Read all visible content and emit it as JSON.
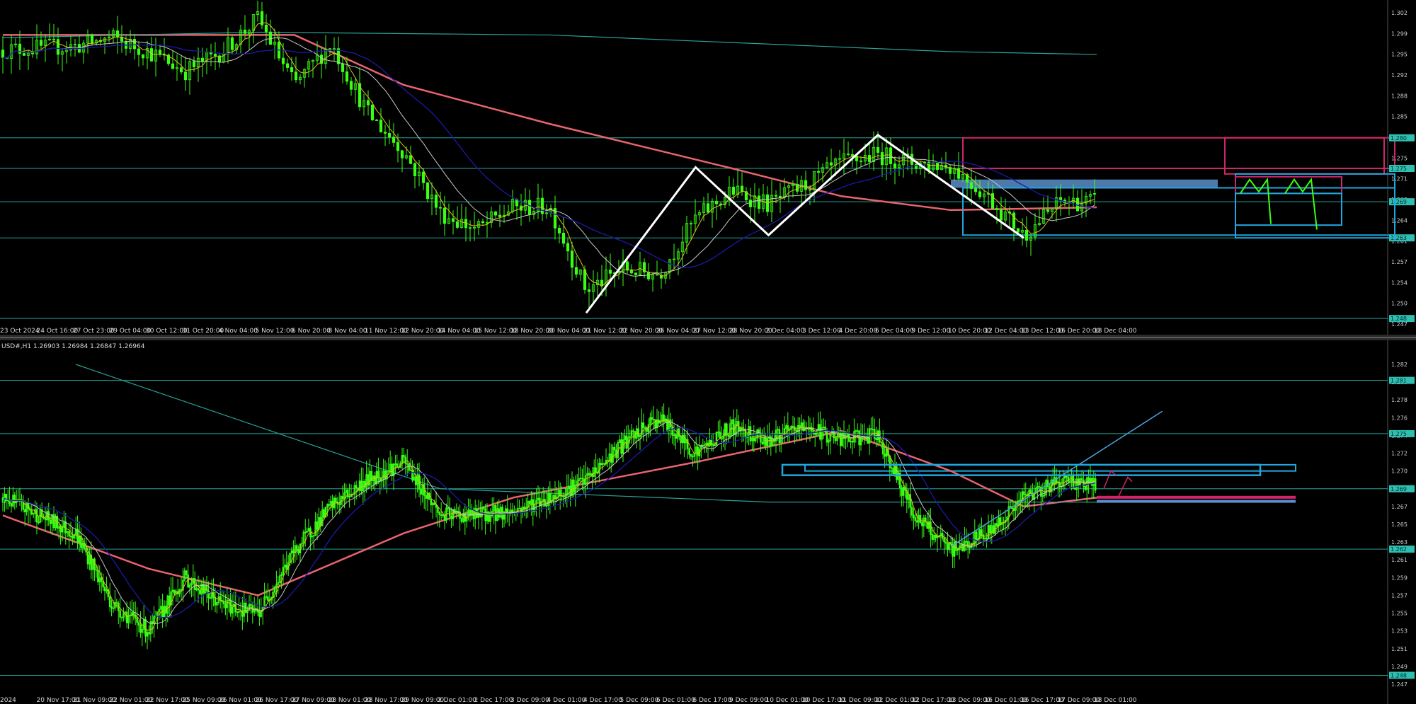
{
  "colors": {
    "background": "#000000",
    "candle": "#39ff14",
    "ma_red": "#e8646e",
    "ma_blue": "#1a1aa8",
    "ma_teal": "#2aa198",
    "ma_gray": "#c8c8c8",
    "ma_yellow": "#e0c020",
    "level_line": "#2fbfb0",
    "pattern_white": "#ffffff",
    "zone_steelblue": "#5b8ec9",
    "zone_cyan": "#1ea7e0",
    "zone_magenta": "#d0256a"
  },
  "top_chart": {
    "header": "",
    "x_ticks": [
      "23 Oct 2024",
      "24 Oct 16:00",
      "27 Oct 23:00",
      "29 Oct 04:00",
      "30 Oct 12:00",
      "31 Oct 20:00",
      "4 Nov 04:00",
      "5 Nov 12:00",
      "6 Nov 20:00",
      "8 Nov 04:00",
      "11 Nov 12:00",
      "12 Nov 20:00",
      "14 Nov 04:00",
      "15 Nov 12:00",
      "18 Nov 20:00",
      "20 Nov 04:00",
      "21 Nov 12:00",
      "22 Nov 20:00",
      "26 Nov 04:00",
      "27 Nov 12:00",
      "28 Nov 20:00",
      "2 Dec 04:00",
      "3 Dec 12:00",
      "4 Dec 20:00",
      "6 Dec 04:00",
      "9 Dec 12:00",
      "10 Dec 20:00",
      "12 Dec 04:00",
      "13 Dec 12:00",
      "16 Dec 20:00",
      "18 Dec 04:00"
    ],
    "y_ticks": [
      "1.302",
      "1.299",
      "1.295",
      "1.292",
      "1.288",
      "1.285",
      "1.278",
      "1.275",
      "1.271",
      "1.268",
      "1.264",
      "1.261",
      "1.257",
      "1.254",
      "1.250",
      "1.247"
    ],
    "price_markers": [
      "1.280",
      "1.275",
      "1.269",
      "1.263",
      "1.248"
    ]
  },
  "bottom_chart": {
    "header": "USD#,H1  1.26903 1.26984 1.26847 1.26964",
    "x_ticks": [
      "2024",
      "20 Nov 17:00",
      "21 Nov 09:00",
      "22 Nov 01:00",
      "22 Nov 17:00",
      "25 Nov 09:00",
      "26 Nov 01:00",
      "26 Nov 17:00",
      "27 Nov 09:00",
      "28 Nov 01:00",
      "28 Nov 17:00",
      "29 Nov 09:00",
      "2 Dec 01:00",
      "2 Dec 17:00",
      "3 Dec 09:00",
      "4 Dec 01:00",
      "4 Dec 17:00",
      "5 Dec 09:00",
      "6 Dec 01:00",
      "6 Dec 17:00",
      "9 Dec 09:00",
      "10 Dec 01:00",
      "10 Dec 17:00",
      "11 Dec 09:00",
      "12 Dec 01:00",
      "12 Dec 17:00",
      "13 Dec 09:00",
      "16 Dec 01:00",
      "16 Dec 17:00",
      "17 Dec 09:00",
      "18 Dec 01:00"
    ],
    "y_ticks": [
      "1.282",
      "1.280",
      "1.278",
      "1.276",
      "1.274",
      "1.272",
      "1.270",
      "1.268",
      "1.267",
      "1.265",
      "1.263",
      "1.261",
      "1.259",
      "1.257",
      "1.255",
      "1.253",
      "1.251",
      "1.249",
      "1.247"
    ],
    "price_markers": [
      "1.281",
      "1.275",
      "1.269",
      "1.262",
      "1.248"
    ]
  },
  "chart_data": [
    {
      "type": "candlestick",
      "timeframe": "H4",
      "x_range": [
        "23 Oct 2024",
        "18 Dec 04:00"
      ],
      "ylim": [
        1.247,
        1.303
      ],
      "close_path": [
        [
          "23 Oct 2024",
          1.2963
        ],
        [
          "27 Oct 23:00",
          1.297
        ],
        [
          "29 Oct 04:00",
          1.2985
        ],
        [
          "30 Oct 12:00",
          1.296
        ],
        [
          "31 Oct 20:00",
          1.2925
        ],
        [
          "4 Nov 04:00",
          1.296
        ],
        [
          "5 Nov 12:00",
          1.302
        ],
        [
          "6 Nov 20:00",
          1.29
        ],
        [
          "8 Nov 04:00",
          1.2975
        ],
        [
          "11 Nov 12:00",
          1.285
        ],
        [
          "12 Nov 20:00",
          1.278
        ],
        [
          "14 Nov 04:00",
          1.267
        ],
        [
          "15 Nov 12:00",
          1.264
        ],
        [
          "18 Nov 20:00",
          1.268
        ],
        [
          "20 Nov 04:00",
          1.268
        ],
        [
          "21 Nov 12:00",
          1.253
        ],
        [
          "22 Nov 20:00",
          1.257
        ],
        [
          "26 Nov 04:00",
          1.256
        ],
        [
          "27 Nov 12:00",
          1.266
        ],
        [
          "28 Nov 20:00",
          1.271
        ],
        [
          "2 Dec 04:00",
          1.2685
        ],
        [
          "3 Dec 12:00",
          1.272
        ],
        [
          "4 Dec 20:00",
          1.276
        ],
        [
          "6 Dec 04:00",
          1.2775
        ],
        [
          "9 Dec 12:00",
          1.276
        ],
        [
          "10 Dec 20:00",
          1.2755
        ],
        [
          "12 Dec 04:00",
          1.27
        ],
        [
          "13 Dec 12:00",
          1.263
        ],
        [
          "16 Dec 20:00",
          1.269
        ],
        [
          "18 Dec 04:00",
          1.269
        ]
      ],
      "moving_averages": [
        {
          "color": "#e8646e",
          "path": [
            [
              "23 Oct 2024",
              1.299
            ],
            [
              "6 Nov 20:00",
              1.299
            ],
            [
              "12 Nov 20:00",
              1.29
            ],
            [
              "20 Nov 04:00",
              1.283
            ],
            [
              "28 Nov 20:00",
              1.275
            ],
            [
              "4 Dec 20:00",
              1.27
            ],
            [
              "10 Dec 20:00",
              1.2675
            ],
            [
              "18 Dec 04:00",
              1.268
            ]
          ]
        },
        {
          "color": "#2aa198",
          "path": [
            [
              "23 Oct 2024",
              1.2985
            ],
            [
              "5 Nov 12:00",
              1.2995
            ],
            [
              "20 Nov 04:00",
              1.299
            ],
            [
              "10 Dec 20:00",
              1.296
            ],
            [
              "18 Dec 04:00",
              1.2955
            ]
          ]
        }
      ],
      "horizontal_levels": [
        1.2805,
        1.275,
        1.269,
        1.2625,
        1.248
      ],
      "pattern": "W/M zigzag",
      "pattern_points": [
        [
          "21 Nov 12:00",
          1.249
        ],
        [
          "27 Nov 12:00",
          1.2752
        ],
        [
          "2 Dec 04:00",
          1.263
        ],
        [
          "6 Dec 04:00",
          1.281
        ],
        [
          "13 Dec 12:00",
          1.2625
        ],
        [
          "18 Dec 01:00",
          1.273
        ]
      ],
      "zones": [
        {
          "color": "#5b8ec9",
          "from": "10 Dec 20:00",
          "y": [
            1.2715,
            1.273
          ]
        },
        {
          "color": "#d0256a",
          "y": [
            1.275,
            1.2805
          ]
        },
        {
          "color": "#1ea7e0",
          "y": [
            1.263,
            1.2715
          ]
        }
      ]
    },
    {
      "type": "candlestick",
      "timeframe": "H1",
      "symbol": "USD#,H1",
      "last_ohlc": {
        "open": 1.26903,
        "high": 1.26984,
        "low": 1.26847,
        "close": 1.26964
      },
      "x_range": [
        "2024",
        "18 Dec 01:00"
      ],
      "ylim": [
        1.247,
        1.283
      ],
      "close_path": [
        [
          "2024",
          1.268
        ],
        [
          "20 Nov 17:00",
          1.266
        ],
        [
          "21 Nov 09:00",
          1.264
        ],
        [
          "22 Nov 01:00",
          1.256
        ],
        [
          "22 Nov 17:00",
          1.253
        ],
        [
          "25 Nov 09:00",
          1.259
        ],
        [
          "26 Nov 01:00",
          1.256
        ],
        [
          "26 Nov 17:00",
          1.255
        ],
        [
          "27 Nov 09:00",
          1.262
        ],
        [
          "28 Nov 01:00",
          1.267
        ],
        [
          "28 Nov 17:00",
          1.27
        ],
        [
          "29 Nov 09:00",
          1.272
        ],
        [
          "2 Dec 01:00",
          1.266
        ],
        [
          "2 Dec 17:00",
          1.266
        ],
        [
          "3 Dec 09:00",
          1.2665
        ],
        [
          "4 Dec 01:00",
          1.268
        ],
        [
          "4 Dec 17:00",
          1.27
        ],
        [
          "5 Dec 09:00",
          1.274
        ],
        [
          "6 Dec 01:00",
          1.277
        ],
        [
          "6 Dec 17:00",
          1.273
        ],
        [
          "9 Dec 09:00",
          1.276
        ],
        [
          "10 Dec 01:00",
          1.2745
        ],
        [
          "10 Dec 17:00",
          1.276
        ],
        [
          "11 Dec 09:00",
          1.2745
        ],
        [
          "12 Dec 01:00",
          1.275
        ],
        [
          "12 Dec 17:00",
          1.266
        ],
        [
          "13 Dec 09:00",
          1.262
        ],
        [
          "16 Dec 01:00",
          1.264
        ],
        [
          "16 Dec 17:00",
          1.268
        ],
        [
          "17 Dec 09:00",
          1.27
        ],
        [
          "18 Dec 01:00",
          1.2695
        ]
      ],
      "moving_averages": [
        {
          "color": "#e8646e",
          "path": [
            [
              "2024",
              1.266
            ],
            [
              "22 Nov 17:00",
              1.26
            ],
            [
              "26 Nov 17:00",
              1.257
            ],
            [
              "29 Nov 09:00",
              1.264
            ],
            [
              "3 Dec 09:00",
              1.268
            ],
            [
              "6 Dec 17:00",
              1.272
            ],
            [
              "11 Dec 09:00",
              1.2755
            ],
            [
              "13 Dec 09:00",
              1.271
            ],
            [
              "16 Dec 17:00",
              1.267
            ],
            [
              "18 Dec 01:00",
              1.268
            ]
          ]
        },
        {
          "color": "#2aa198",
          "path": [
            [
              "21 Nov 09:00",
              1.283
            ],
            [
              "2 Dec 01:00",
              1.269
            ],
            [
              "10 Dec 01:00",
              1.2675
            ],
            [
              "18 Dec 01:00",
              1.2675
            ]
          ]
        }
      ],
      "horizontal_levels": [
        1.2812,
        1.2752,
        1.269,
        1.2622,
        1.248
      ],
      "trendline": [
        [
          "13 Dec 09:00",
          1.2625
        ],
        [
          "18 Dec 01:00",
          1.273
        ]
      ],
      "zones": [
        {
          "color": "#1ea7e0",
          "from": "10 Dec 17:00",
          "y": [
            1.271,
            1.2717
          ]
        },
        {
          "color": "#d0256a",
          "from": "18 Dec 01:00",
          "y": [
            1.2679,
            1.2682
          ]
        }
      ]
    }
  ]
}
